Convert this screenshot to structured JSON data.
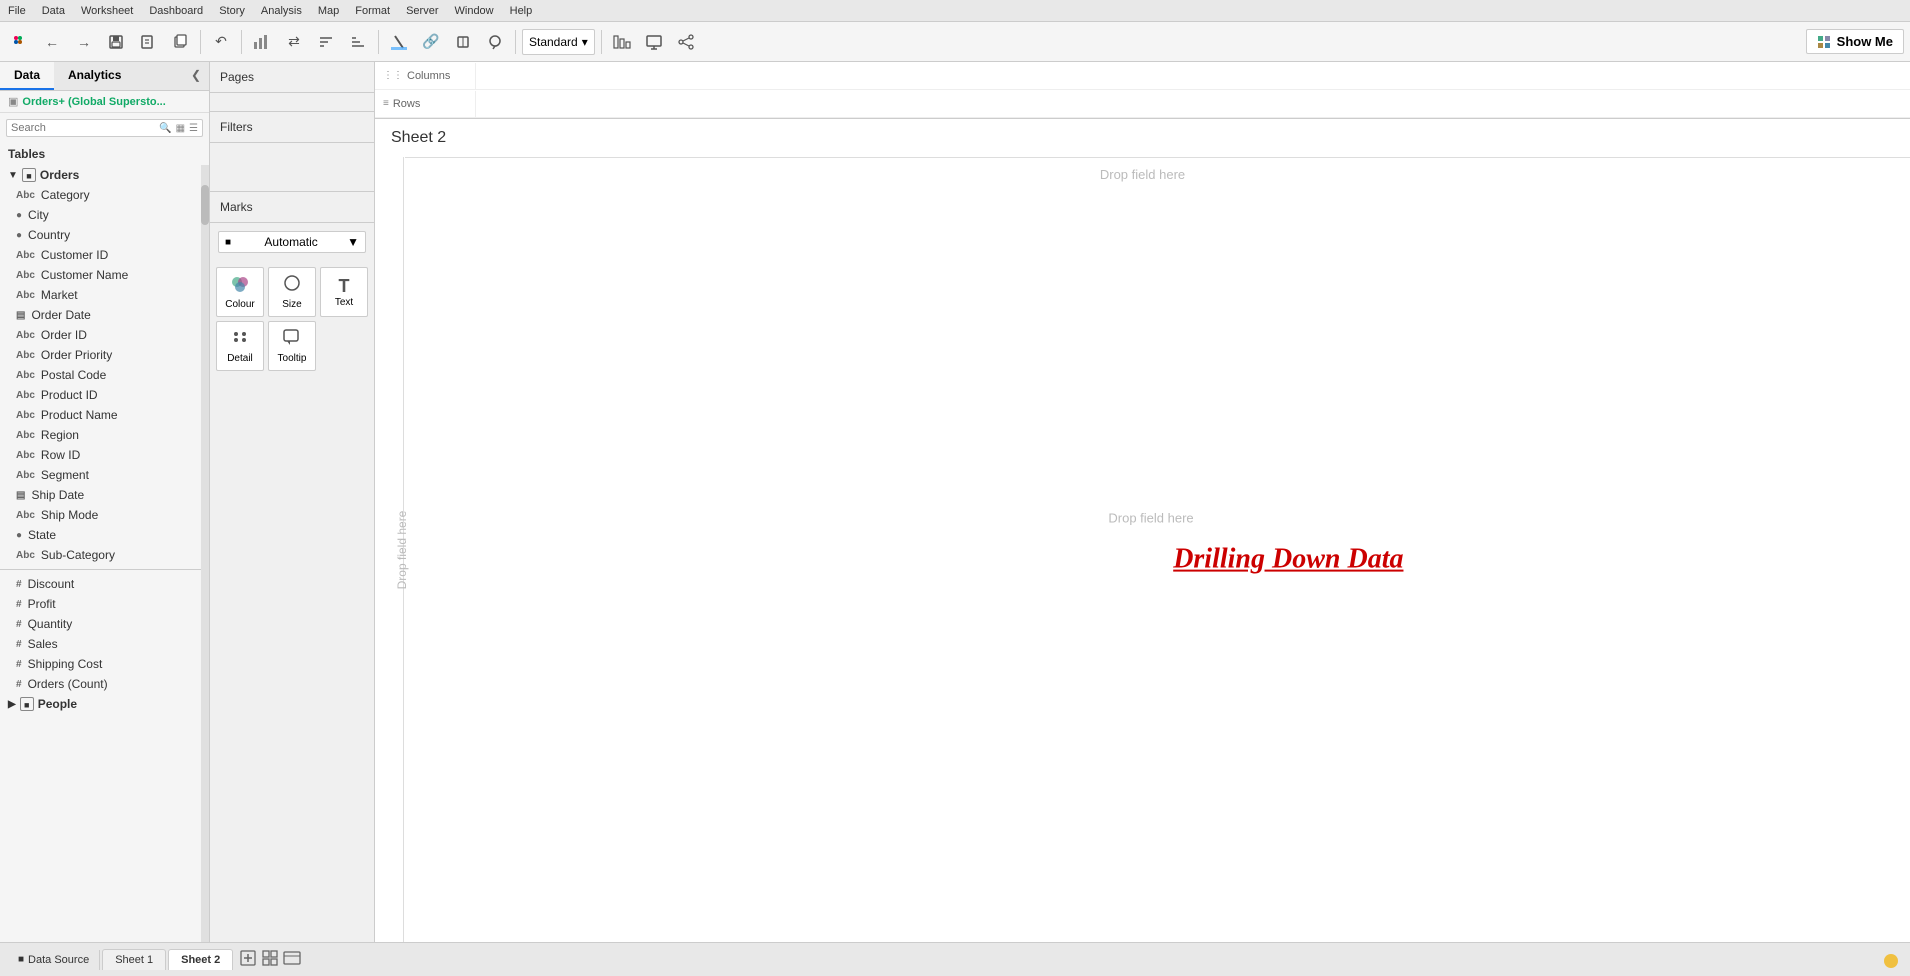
{
  "menubar": {
    "items": [
      "File",
      "Data",
      "Worksheet",
      "Dashboard",
      "Story",
      "Analysis",
      "Map",
      "Format",
      "Server",
      "Window",
      "Help"
    ]
  },
  "toolbar": {
    "dropdown_label": "Standard",
    "show_me_label": "Show Me"
  },
  "left_panel": {
    "tab_data": "Data",
    "tab_analytics": "Analytics",
    "search_placeholder": "Search",
    "tables_header": "Tables",
    "orders_section": "Orders",
    "people_section": "People",
    "fields": [
      {
        "name": "Category",
        "type": "abc"
      },
      {
        "name": "City",
        "type": "globe"
      },
      {
        "name": "Country",
        "type": "globe"
      },
      {
        "name": "Customer ID",
        "type": "abc"
      },
      {
        "name": "Customer Name",
        "type": "abc"
      },
      {
        "name": "Market",
        "type": "abc"
      },
      {
        "name": "Order Date",
        "type": "calendar"
      },
      {
        "name": "Order ID",
        "type": "abc"
      },
      {
        "name": "Order Priority",
        "type": "abc"
      },
      {
        "name": "Postal Code",
        "type": "abc"
      },
      {
        "name": "Product ID",
        "type": "abc"
      },
      {
        "name": "Product Name",
        "type": "abc"
      },
      {
        "name": "Region",
        "type": "abc"
      },
      {
        "name": "Row ID",
        "type": "abc"
      },
      {
        "name": "Segment",
        "type": "abc"
      },
      {
        "name": "Ship Date",
        "type": "calendar"
      },
      {
        "name": "Ship Mode",
        "type": "abc"
      },
      {
        "name": "State",
        "type": "globe"
      },
      {
        "name": "Sub-Category",
        "type": "abc"
      },
      {
        "name": "Discount",
        "type": "hash"
      },
      {
        "name": "Profit",
        "type": "hash"
      },
      {
        "name": "Quantity",
        "type": "hash"
      },
      {
        "name": "Sales",
        "type": "hash"
      },
      {
        "name": "Shipping Cost",
        "type": "hash"
      },
      {
        "name": "Orders (Count)",
        "type": "hash"
      }
    ],
    "datasource": "Orders+ (Global Supersto..."
  },
  "middle_panel": {
    "pages_label": "Pages",
    "filters_label": "Filters",
    "marks_label": "Marks",
    "marks_type": "Automatic",
    "marks_buttons": [
      {
        "label": "Colour",
        "icon": "⬤"
      },
      {
        "label": "Size",
        "icon": "◯"
      },
      {
        "label": "Text",
        "icon": "T"
      },
      {
        "label": "Detail",
        "icon": "⁙"
      },
      {
        "label": "Tooltip",
        "icon": "💬"
      }
    ]
  },
  "canvas": {
    "columns_label": "Columns",
    "rows_label": "Rows",
    "sheet_title": "Sheet 2",
    "drop_field_top": "Drop field here",
    "drop_field_mid": "Drop field here",
    "drop_field_left": "Drop\nfield\nhere",
    "drilling_text": "Drilling Down Data"
  },
  "bottom_bar": {
    "data_source_label": "Data Source",
    "sheet1_label": "Sheet 1",
    "sheet2_label": "Sheet 2"
  }
}
